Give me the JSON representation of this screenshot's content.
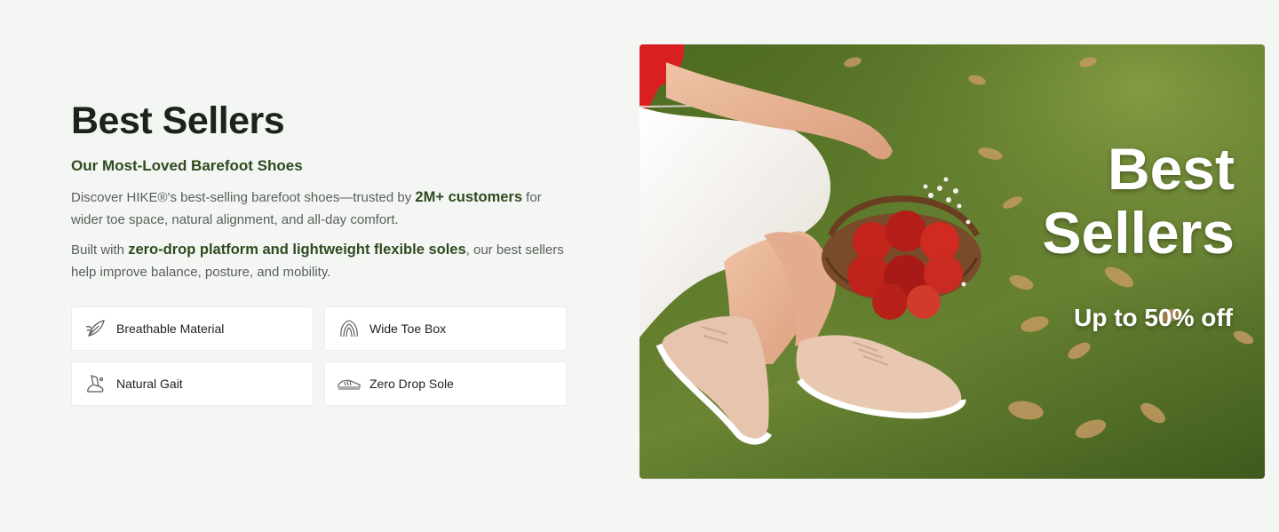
{
  "section": {
    "title": "Best Sellers",
    "subtitle": "Our Most-Loved Barefoot Shoes",
    "paragraph1": {
      "before": "Discover HIKE®'s best-selling barefoot shoes—trusted by ",
      "highlight": "2M+ customers",
      "after": " for wider toe space, natural alignment, and all-day comfort."
    },
    "paragraph2": {
      "before": "Built with ",
      "highlight": "zero-drop platform and lightweight flexible soles",
      "after": ", our best sellers help improve balance, posture, and mobility."
    }
  },
  "features": [
    {
      "label": "Breathable Material",
      "icon": "breathable-leaf-icon"
    },
    {
      "label": "Wide Toe Box",
      "icon": "wide-toe-icon"
    },
    {
      "label": "Natural Gait",
      "icon": "foot-gait-icon"
    },
    {
      "label": "Zero Drop Sole",
      "icon": "shoe-sole-icon"
    }
  ],
  "hero": {
    "title_line1": "Best",
    "title_line2": "Sellers",
    "promo": "Up to 50% off"
  }
}
